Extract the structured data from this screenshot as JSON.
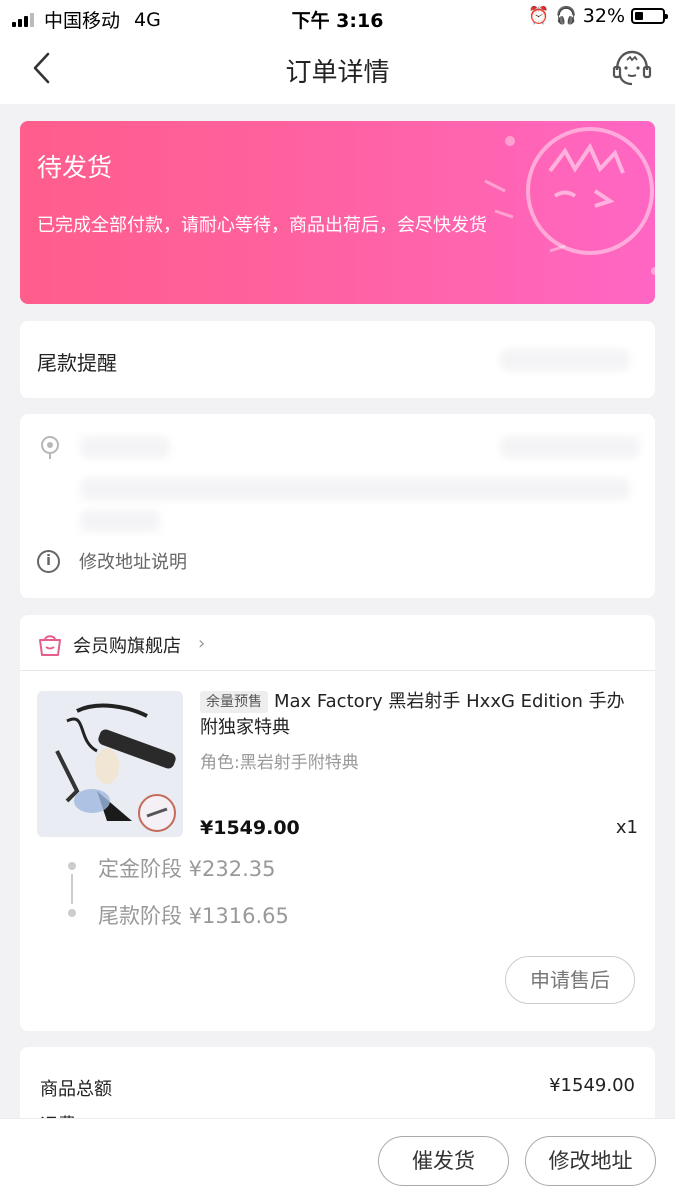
{
  "status_bar": {
    "carrier": "中国移动",
    "network": "4G",
    "time": "下午 3:16",
    "battery": "32%",
    "battery_level": 0.32
  },
  "nav": {
    "title": "订单详情"
  },
  "banner": {
    "title": "待发货",
    "description": "已完成全部付款，请耐心等待，商品出荷后，会尽快发货"
  },
  "reminder": {
    "label": "尾款提醒"
  },
  "address": {
    "info_label": "修改地址说明"
  },
  "order": {
    "shop_name": "会员购旗舰店",
    "product": {
      "tag": "余量预售",
      "title": "Max Factory 黑岩射手 HxxG Edition 手办 附独家特典",
      "variant": "角色:黑岩射手附特典",
      "price": "¥1549.00",
      "qty": "x1"
    },
    "stages": [
      {
        "label": "定金阶段 ¥232.35"
      },
      {
        "label": "尾款阶段 ¥1316.65"
      }
    ],
    "aftersale_label": "申请售后"
  },
  "summary": {
    "total_label": "商品总额",
    "total_value": "¥1549.00",
    "shipping_label": "运费"
  },
  "bottom": {
    "urge_label": "催发货",
    "modify_label": "修改地址"
  },
  "colors": {
    "banner_start": "#ff5d8b",
    "banner_end": "#ff66c4",
    "shop_icon": "#e85d8e"
  }
}
